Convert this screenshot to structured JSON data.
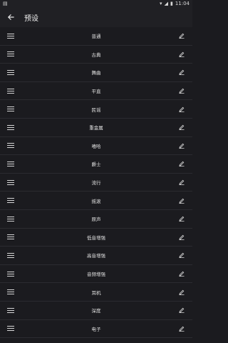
{
  "status_bar": {
    "time": "11:04"
  },
  "app_bar": {
    "title": "预设"
  },
  "presets": [
    {
      "name": "普通"
    },
    {
      "name": "古典"
    },
    {
      "name": "舞曲"
    },
    {
      "name": "平直"
    },
    {
      "name": "民谣"
    },
    {
      "name": "重金属"
    },
    {
      "name": "嘻哈"
    },
    {
      "name": "爵士"
    },
    {
      "name": "流行"
    },
    {
      "name": "摇滚"
    },
    {
      "name": "原声"
    },
    {
      "name": "低音增强"
    },
    {
      "name": "高音增强"
    },
    {
      "name": "音频增强"
    },
    {
      "name": "耳机"
    },
    {
      "name": "深度"
    },
    {
      "name": "电子"
    }
  ],
  "icons": {
    "back": "arrow-back-icon",
    "drag": "drag-handle-icon",
    "edit": "edit-pencil-icon"
  }
}
